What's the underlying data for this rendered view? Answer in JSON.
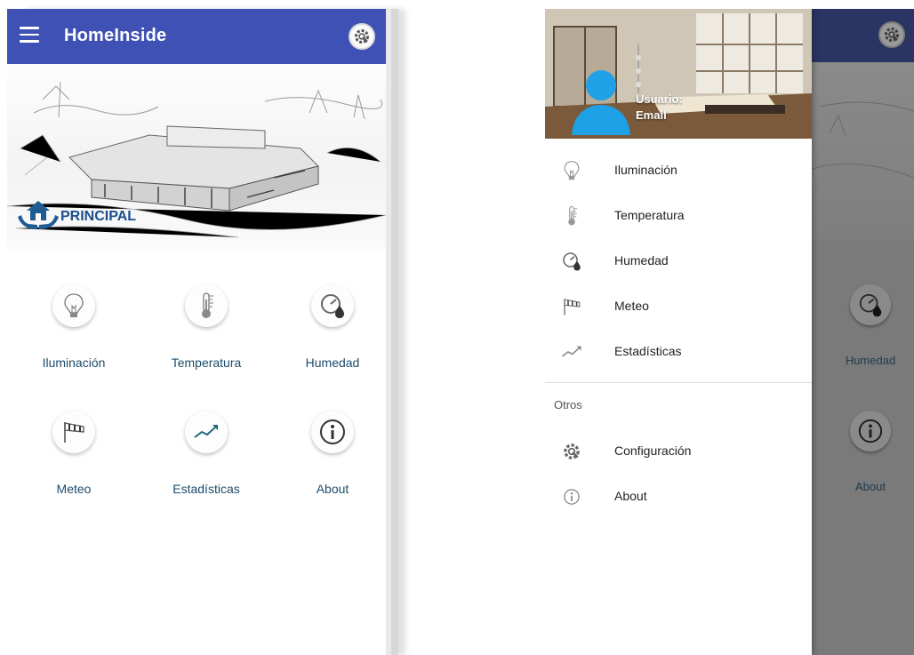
{
  "left_screen": {
    "app_title": "HomeInside",
    "hero_label": "PRINCIPAL",
    "grid": [
      {
        "label": "Iluminación",
        "icon": "lightbulb-icon"
      },
      {
        "label": "Temperatura",
        "icon": "thermometer-icon"
      },
      {
        "label": "Humedad",
        "icon": "humidity-gauge-icon"
      },
      {
        "label": "Meteo",
        "icon": "windsock-icon"
      },
      {
        "label": "Estadísticas",
        "icon": "trending-chart-icon"
      },
      {
        "label": "About",
        "icon": "info-icon"
      }
    ]
  },
  "right_screen": {
    "user": {
      "name": "Usuario:",
      "email": "Email"
    },
    "menu": [
      {
        "label": "Iluminación",
        "icon": "lightbulb-icon"
      },
      {
        "label": "Temperatura",
        "icon": "thermometer-icon"
      },
      {
        "label": "Humedad",
        "icon": "humidity-gauge-icon"
      },
      {
        "label": "Meteo",
        "icon": "windsock-icon"
      },
      {
        "label": "Estadísticas",
        "icon": "trending-chart-icon"
      }
    ],
    "section_title": "Otros",
    "other_menu": [
      {
        "label": "Configuración",
        "icon": "settings-gear-icon"
      },
      {
        "label": "About",
        "icon": "info-icon"
      }
    ],
    "background_labels": {
      "humedad": "Humedad",
      "about": "About"
    }
  },
  "colors": {
    "primary": "#3f51b5",
    "label_text": "#1b4b6b",
    "hero_text": "#1b4f8f"
  }
}
